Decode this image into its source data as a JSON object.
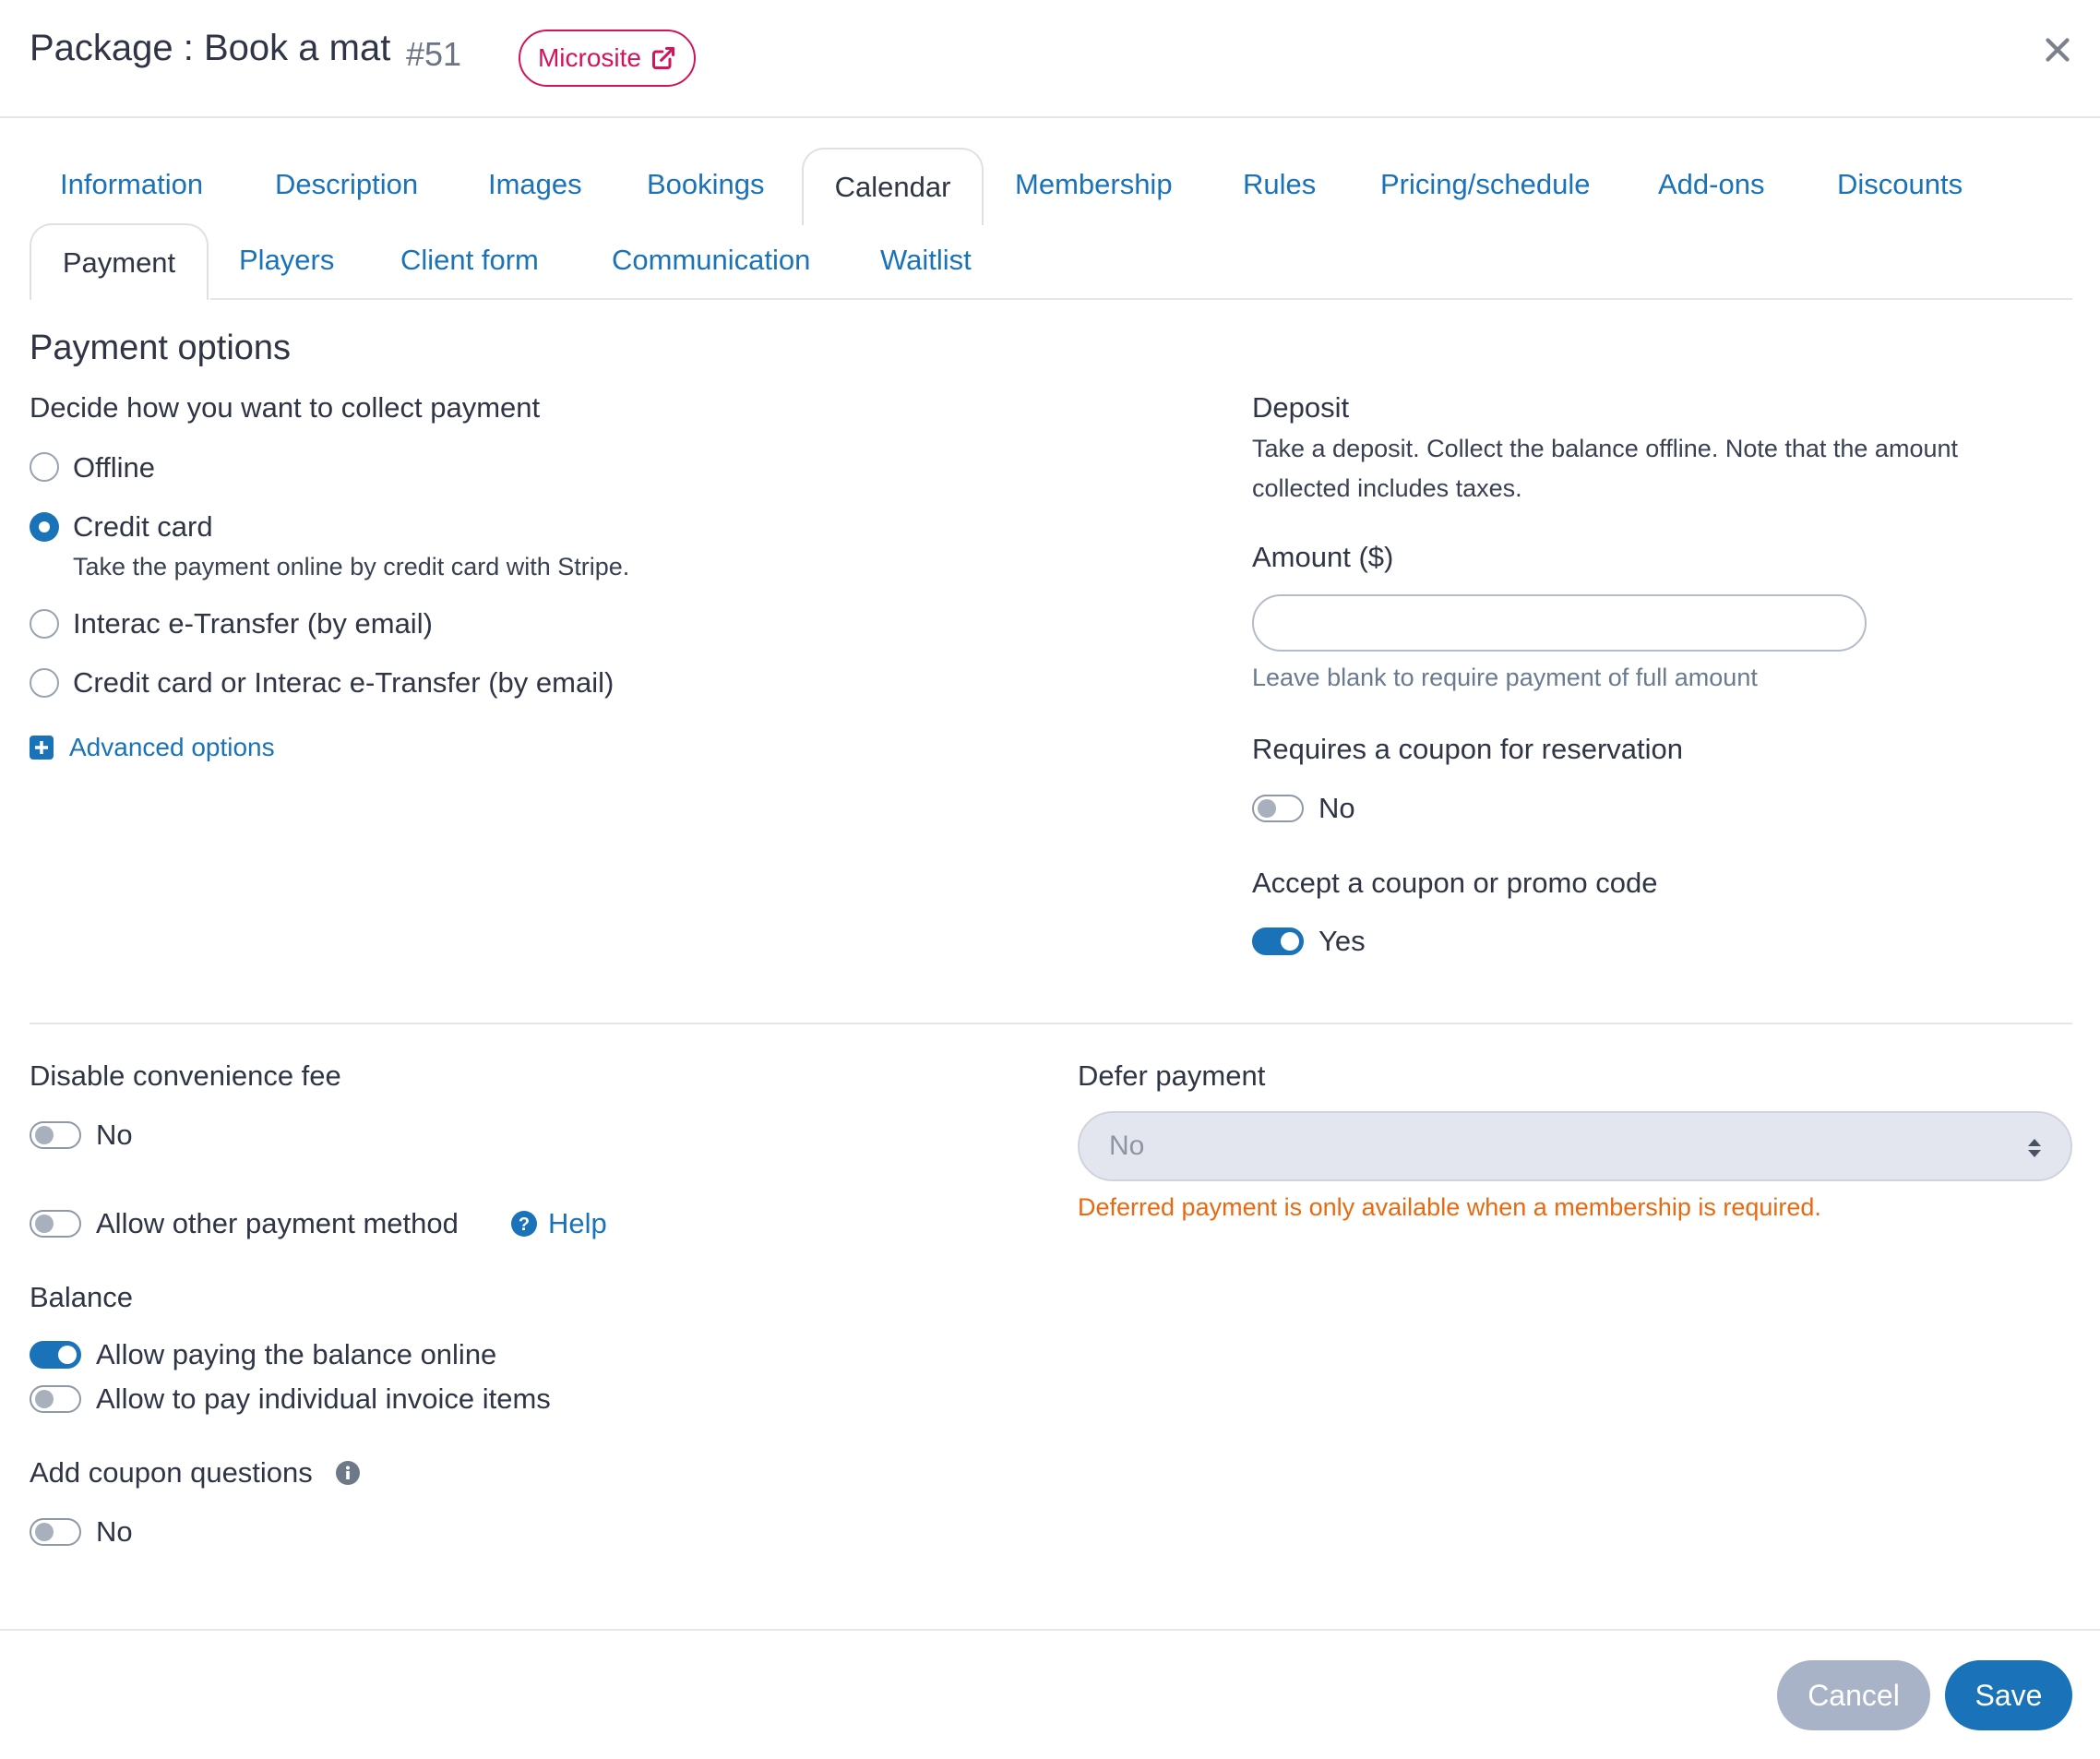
{
  "header": {
    "title": "Package : Book a mat",
    "id": "#51",
    "microsite_label": "Microsite"
  },
  "tabs_row1": [
    "Information",
    "Description",
    "Images",
    "Bookings",
    "Calendar",
    "Membership",
    "Rules",
    "Pricing/schedule",
    "Add-ons",
    "Discounts"
  ],
  "tabs_row2": [
    "Payment",
    "Players",
    "Client form",
    "Communication",
    "Waitlist"
  ],
  "payment_options": {
    "title": "Payment options",
    "subtitle": "Decide how you want to collect payment",
    "options": [
      {
        "label": "Offline",
        "checked": false
      },
      {
        "label": "Credit card",
        "checked": true,
        "description": "Take the payment online by credit card with Stripe."
      },
      {
        "label": "Interac e-Transfer (by email)",
        "checked": false
      },
      {
        "label": "Credit card or Interac e-Transfer (by email)",
        "checked": false
      }
    ],
    "advanced_options": "Advanced options"
  },
  "deposit": {
    "title": "Deposit",
    "description": "Take a deposit. Collect the balance offline. Note that the amount collected includes taxes.",
    "amount_label": "Amount ($)",
    "amount_value": "",
    "amount_hint": "Leave blank to require payment of full amount"
  },
  "coupon_required": {
    "label": "Requires a coupon for reservation",
    "value": "No",
    "on": false
  },
  "accept_coupon": {
    "label": "Accept a coupon or promo code",
    "value": "Yes",
    "on": true
  },
  "convenience_fee": {
    "label": "Disable convenience fee",
    "value": "No",
    "on": false
  },
  "other_method": {
    "label": "Allow other payment method",
    "on": false,
    "help": "Help"
  },
  "balance": {
    "title": "Balance",
    "items": [
      {
        "label": "Allow paying the balance online",
        "on": true
      },
      {
        "label": "Allow to pay individual invoice items",
        "on": false
      }
    ]
  },
  "coupon_questions": {
    "label": "Add coupon questions",
    "value": "No",
    "on": false
  },
  "defer_payment": {
    "label": "Defer payment",
    "selected": "No",
    "warning": "Deferred payment is only available when a membership is required."
  },
  "footer": {
    "cancel": "Cancel",
    "save": "Save"
  },
  "colors": {
    "primary": "#1a73b8",
    "microsite": "#d4145a",
    "warning": "#e86a10",
    "cancel": "#a9b3c7"
  }
}
